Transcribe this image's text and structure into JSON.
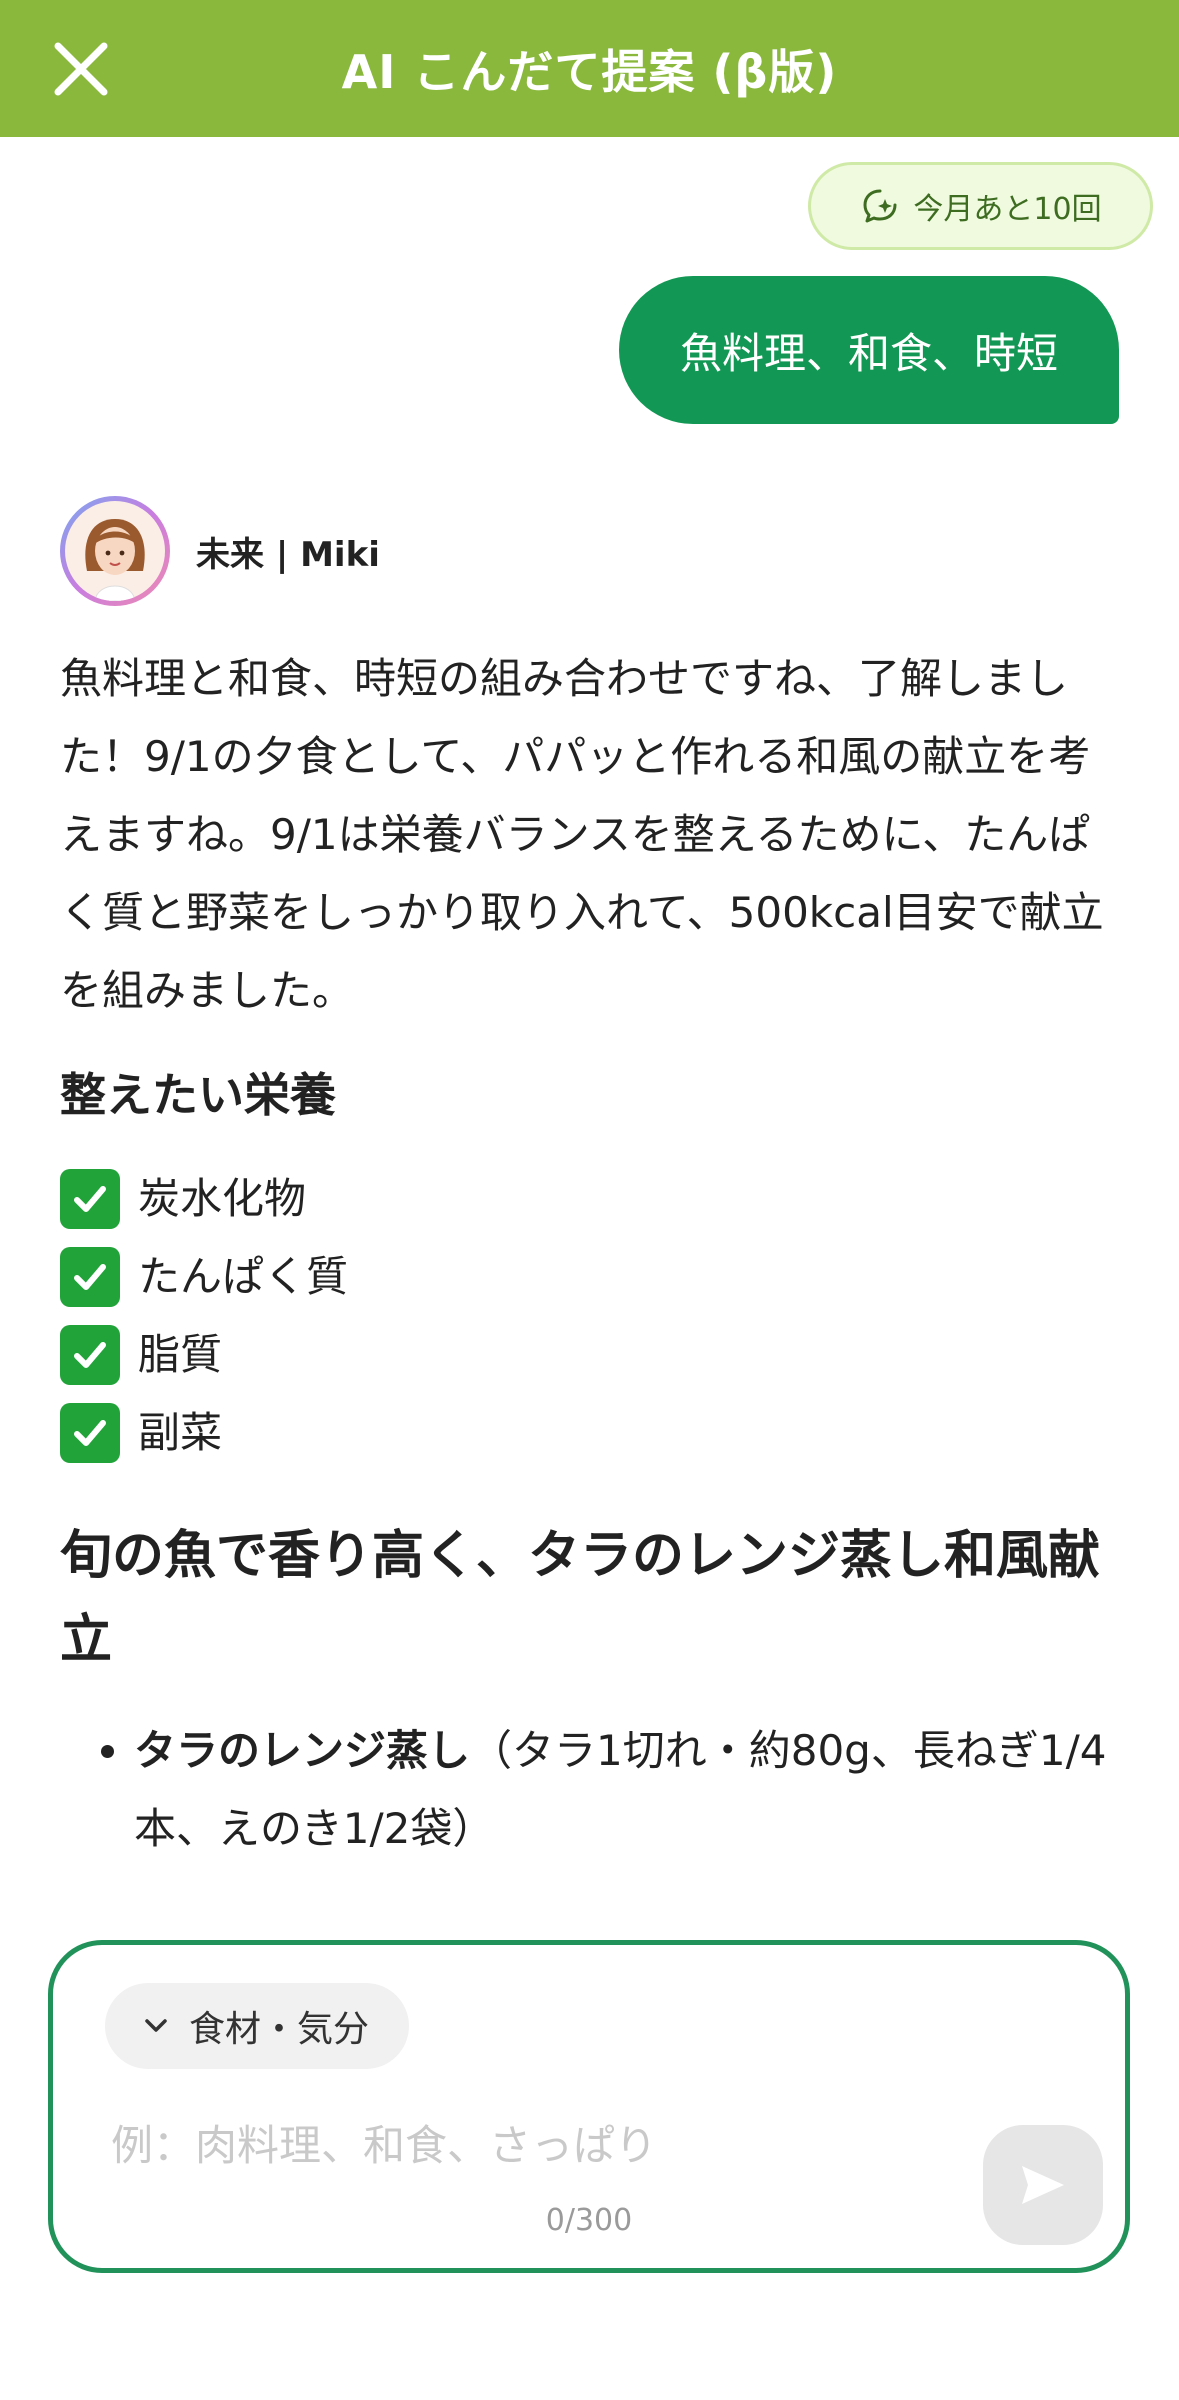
{
  "header": {
    "title": "AI こんだて提案 (β版)",
    "close_icon": "close-icon"
  },
  "quota": {
    "label": "今月あと10回",
    "icon": "sparkle-chat-icon"
  },
  "user_message": {
    "text": "魚料理、和食、時短"
  },
  "assistant": {
    "name": "未来 | Miki",
    "intro": "魚料理と和食、時短の組み合わせですね、了解しました！9/1の夕食として、パパッと作れる和風の献立を考えますね。9/1は栄養バランスを整えるために、たんぱく質と野菜をしっかり取り入れて、500kcal目安で献立を組みました。",
    "nutrition_heading": "整えたい栄養",
    "nutrition_items": [
      "炭水化物",
      "たんぱく質",
      "脂質",
      "副菜"
    ],
    "menu_title": "旬の魚で香り高く、タラのレンジ蒸し和風献立",
    "dishes": [
      {
        "name": "タラのレンジ蒸し",
        "detail": "（タラ1切れ・約80g、長ねぎ1/4本、えのき1/2袋）"
      }
    ]
  },
  "composer": {
    "chip_label": "食材・気分",
    "placeholder": "例：肉料理、和食、さっぱり",
    "counter": "0/300"
  },
  "colors": {
    "header_bg": "#8ab83c",
    "user_bubble": "#129854",
    "composer_border": "#21925a",
    "check_green": "#21a33a"
  }
}
